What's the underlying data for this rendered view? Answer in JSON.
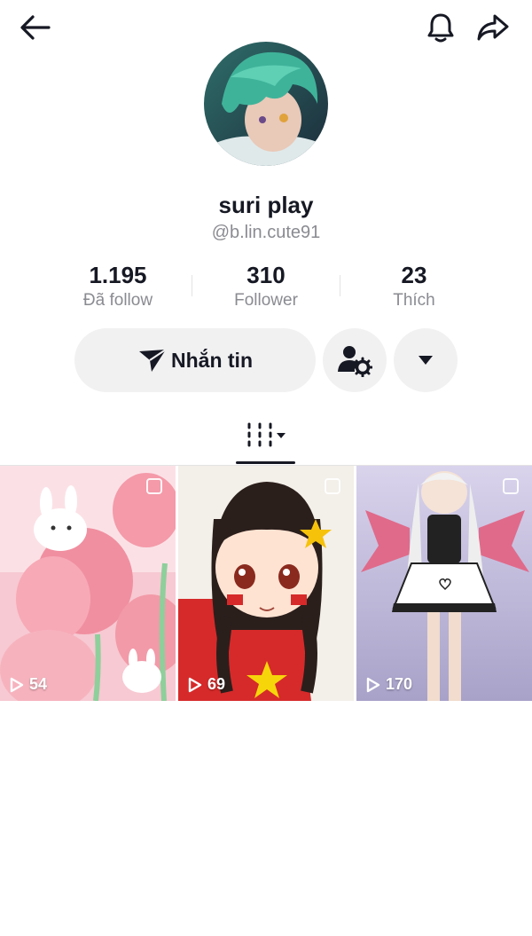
{
  "header": {
    "back_icon": "arrow-left-icon",
    "notification_icon": "bell-icon",
    "share_icon": "share-arrow-icon"
  },
  "profile": {
    "display_name": "suri play",
    "username": "@b.lin.cute91"
  },
  "stats": [
    {
      "value": "1.195",
      "label": "Đã follow"
    },
    {
      "value": "310",
      "label": "Follower"
    },
    {
      "value": "23",
      "label": "Thích"
    }
  ],
  "actions": {
    "message_label": "Nhắn tin",
    "message_icon": "paper-plane-icon",
    "follow_settings_icon": "person-gear-icon",
    "more_icon": "triangle-down-icon"
  },
  "tabs": {
    "videos_icon": "grid-bars-icon"
  },
  "videos": [
    {
      "views": "54"
    },
    {
      "views": "69"
    },
    {
      "views": "170"
    }
  ],
  "colors": {
    "text": "#161823",
    "secondary_text": "#8a8b91",
    "button_bg": "#f1f1f2"
  }
}
